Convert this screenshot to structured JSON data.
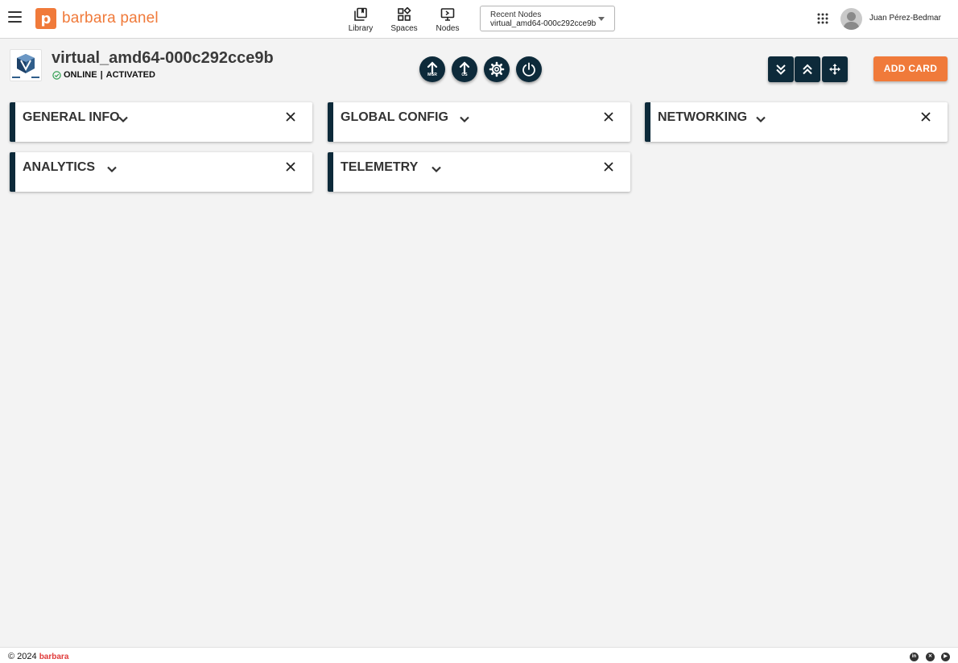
{
  "header": {
    "brand": "barbara panel",
    "brand_letter": "p",
    "nav": [
      {
        "label": "Library",
        "icon": "library-icon"
      },
      {
        "label": "Spaces",
        "icon": "spaces-icon"
      },
      {
        "label": "Nodes",
        "icon": "nodes-icon"
      }
    ],
    "recent_nodes": {
      "label": "Recent Nodes",
      "value": "virtual_amd64-000c292cce9b"
    },
    "user": {
      "name": "Juan Pérez-Bedmar"
    }
  },
  "node": {
    "name": "virtual_amd64-000c292cce9b",
    "status": "ONLINE",
    "separator": "|",
    "activation": "ACTIVATED",
    "actions": [
      {
        "icon": "update-mgr-icon",
        "sublabel": "MGR"
      },
      {
        "icon": "update-os-icon",
        "sublabel": "OS"
      },
      {
        "icon": "gear-icon",
        "sublabel": ""
      },
      {
        "icon": "power-icon",
        "sublabel": ""
      }
    ]
  },
  "toolbar": {
    "add_card_label": "ADD CARD"
  },
  "cards": [
    {
      "title": "GENERAL INFO"
    },
    {
      "title": "GLOBAL CONFIG"
    },
    {
      "title": "NETWORKING"
    },
    {
      "title": "ANALYTICS"
    },
    {
      "title": "TELEMETRY"
    }
  ],
  "footer": {
    "copyright": "© 2024",
    "brand": "barbara"
  },
  "colors": {
    "accent": "#f07a3a",
    "dark": "#0d2a3a",
    "status_ok": "#2e9e4f"
  }
}
